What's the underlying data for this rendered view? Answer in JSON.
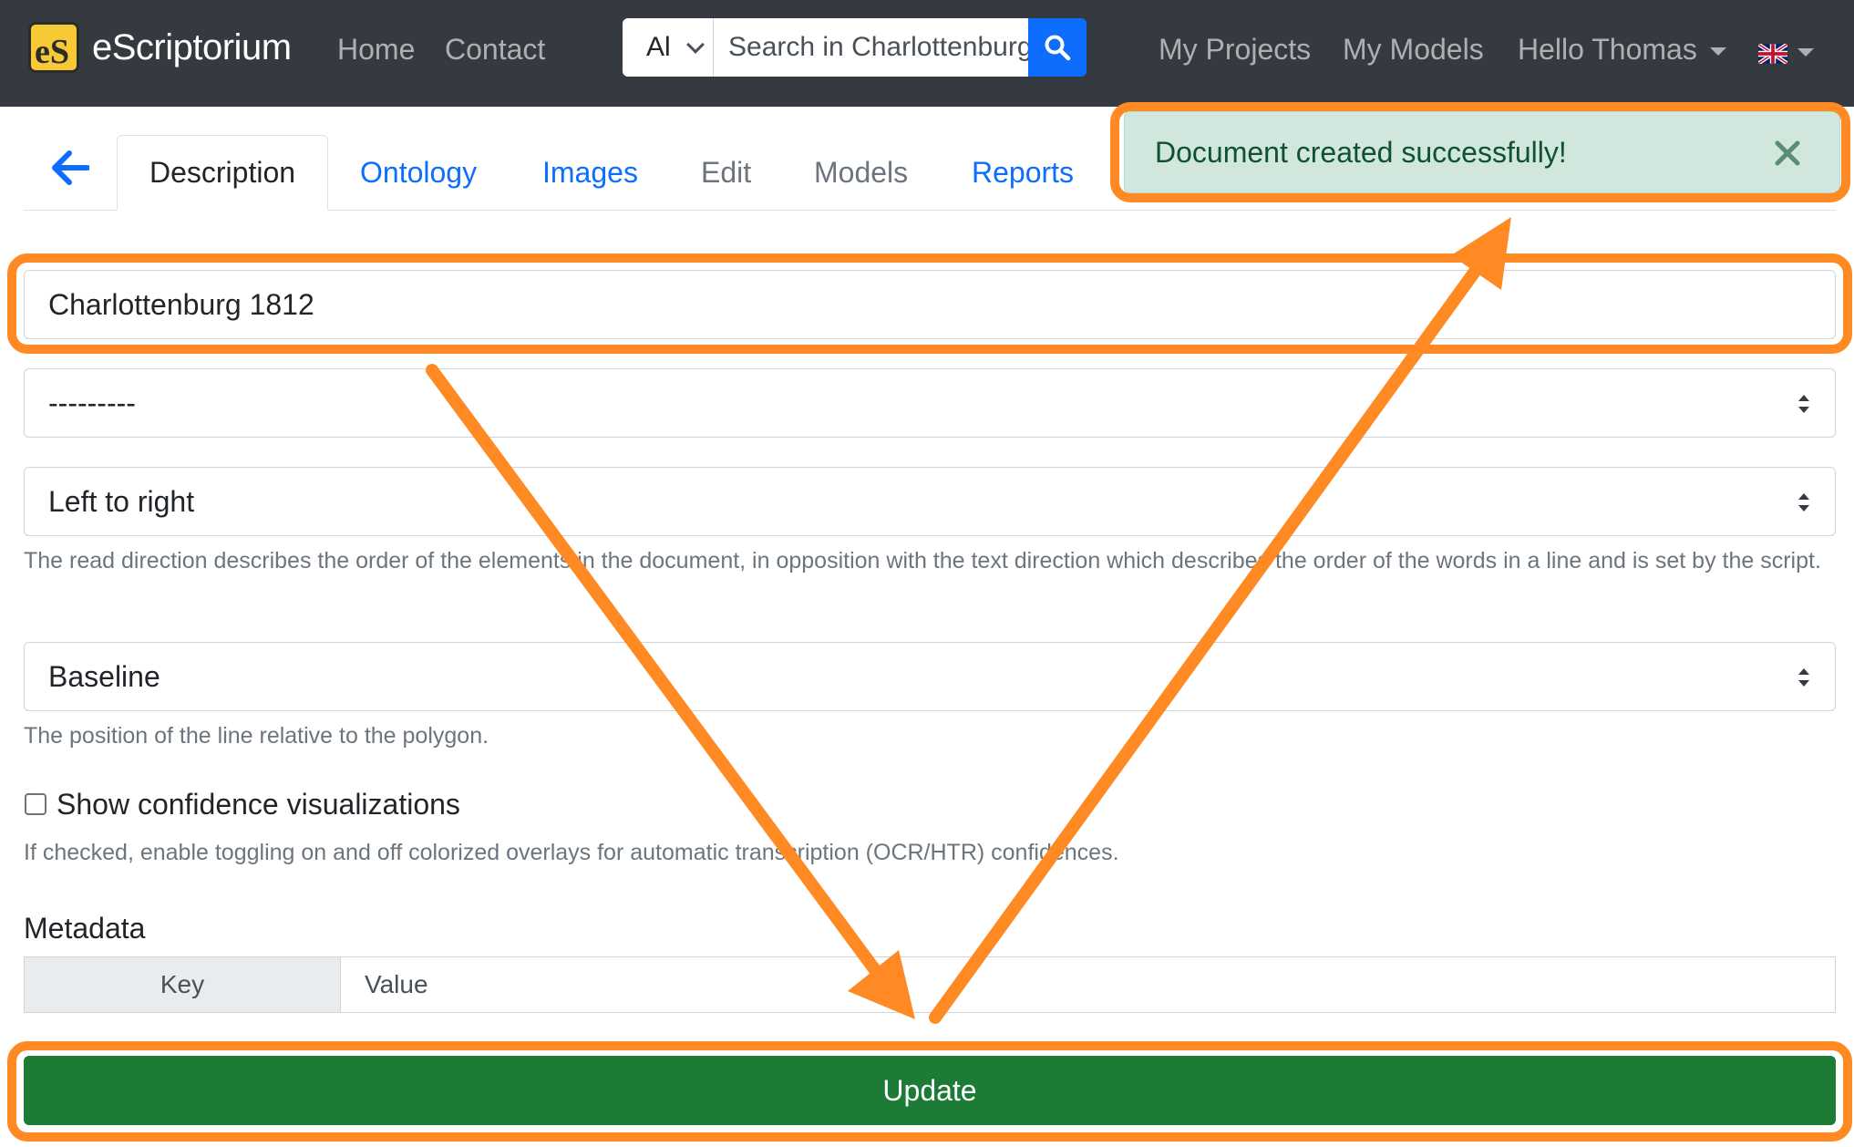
{
  "navbar": {
    "brand_logo_text": "eS",
    "brand_name": "eScriptorium",
    "home_label": "Home",
    "contact_label": "Contact",
    "search_scope": "Al",
    "search_placeholder": "Search in Charlottenburg",
    "my_projects_label": "My Projects",
    "my_models_label": "My Models",
    "user_menu_label": "Hello Thomas",
    "language_flag": "uk-flag-icon"
  },
  "tabs": {
    "description": "Description",
    "ontology": "Ontology",
    "images": "Images",
    "edit": "Edit",
    "models": "Models",
    "reports": "Reports"
  },
  "alert": {
    "message": "Document created successfully!"
  },
  "form": {
    "name_value": "Charlottenburg 1812",
    "script_value": "---------",
    "read_direction_value": "Left to right",
    "read_direction_help": "The read direction describes the order of the elements in the document, in opposition with the text direction which describes the order of the words in a line and is set by the script.",
    "line_position_value": "Baseline",
    "line_position_help": "The position of the line relative to the polygon.",
    "confidence_label": "Show confidence visualizations",
    "confidence_help": "If checked, enable toggling on and off colorized overlays for automatic transcription (OCR/HTR) confidences.",
    "metadata_title": "Metadata",
    "metadata_key_header": "Key",
    "metadata_value_placeholder": "Value",
    "update_label": "Update"
  },
  "colors": {
    "navbar_bg": "#343a40",
    "link_blue": "#0d6efd",
    "success_bg": "#d1e7dd",
    "success_text": "#0f5132",
    "update_green": "#1c7c36",
    "annotation_orange": "#ff8a24"
  }
}
